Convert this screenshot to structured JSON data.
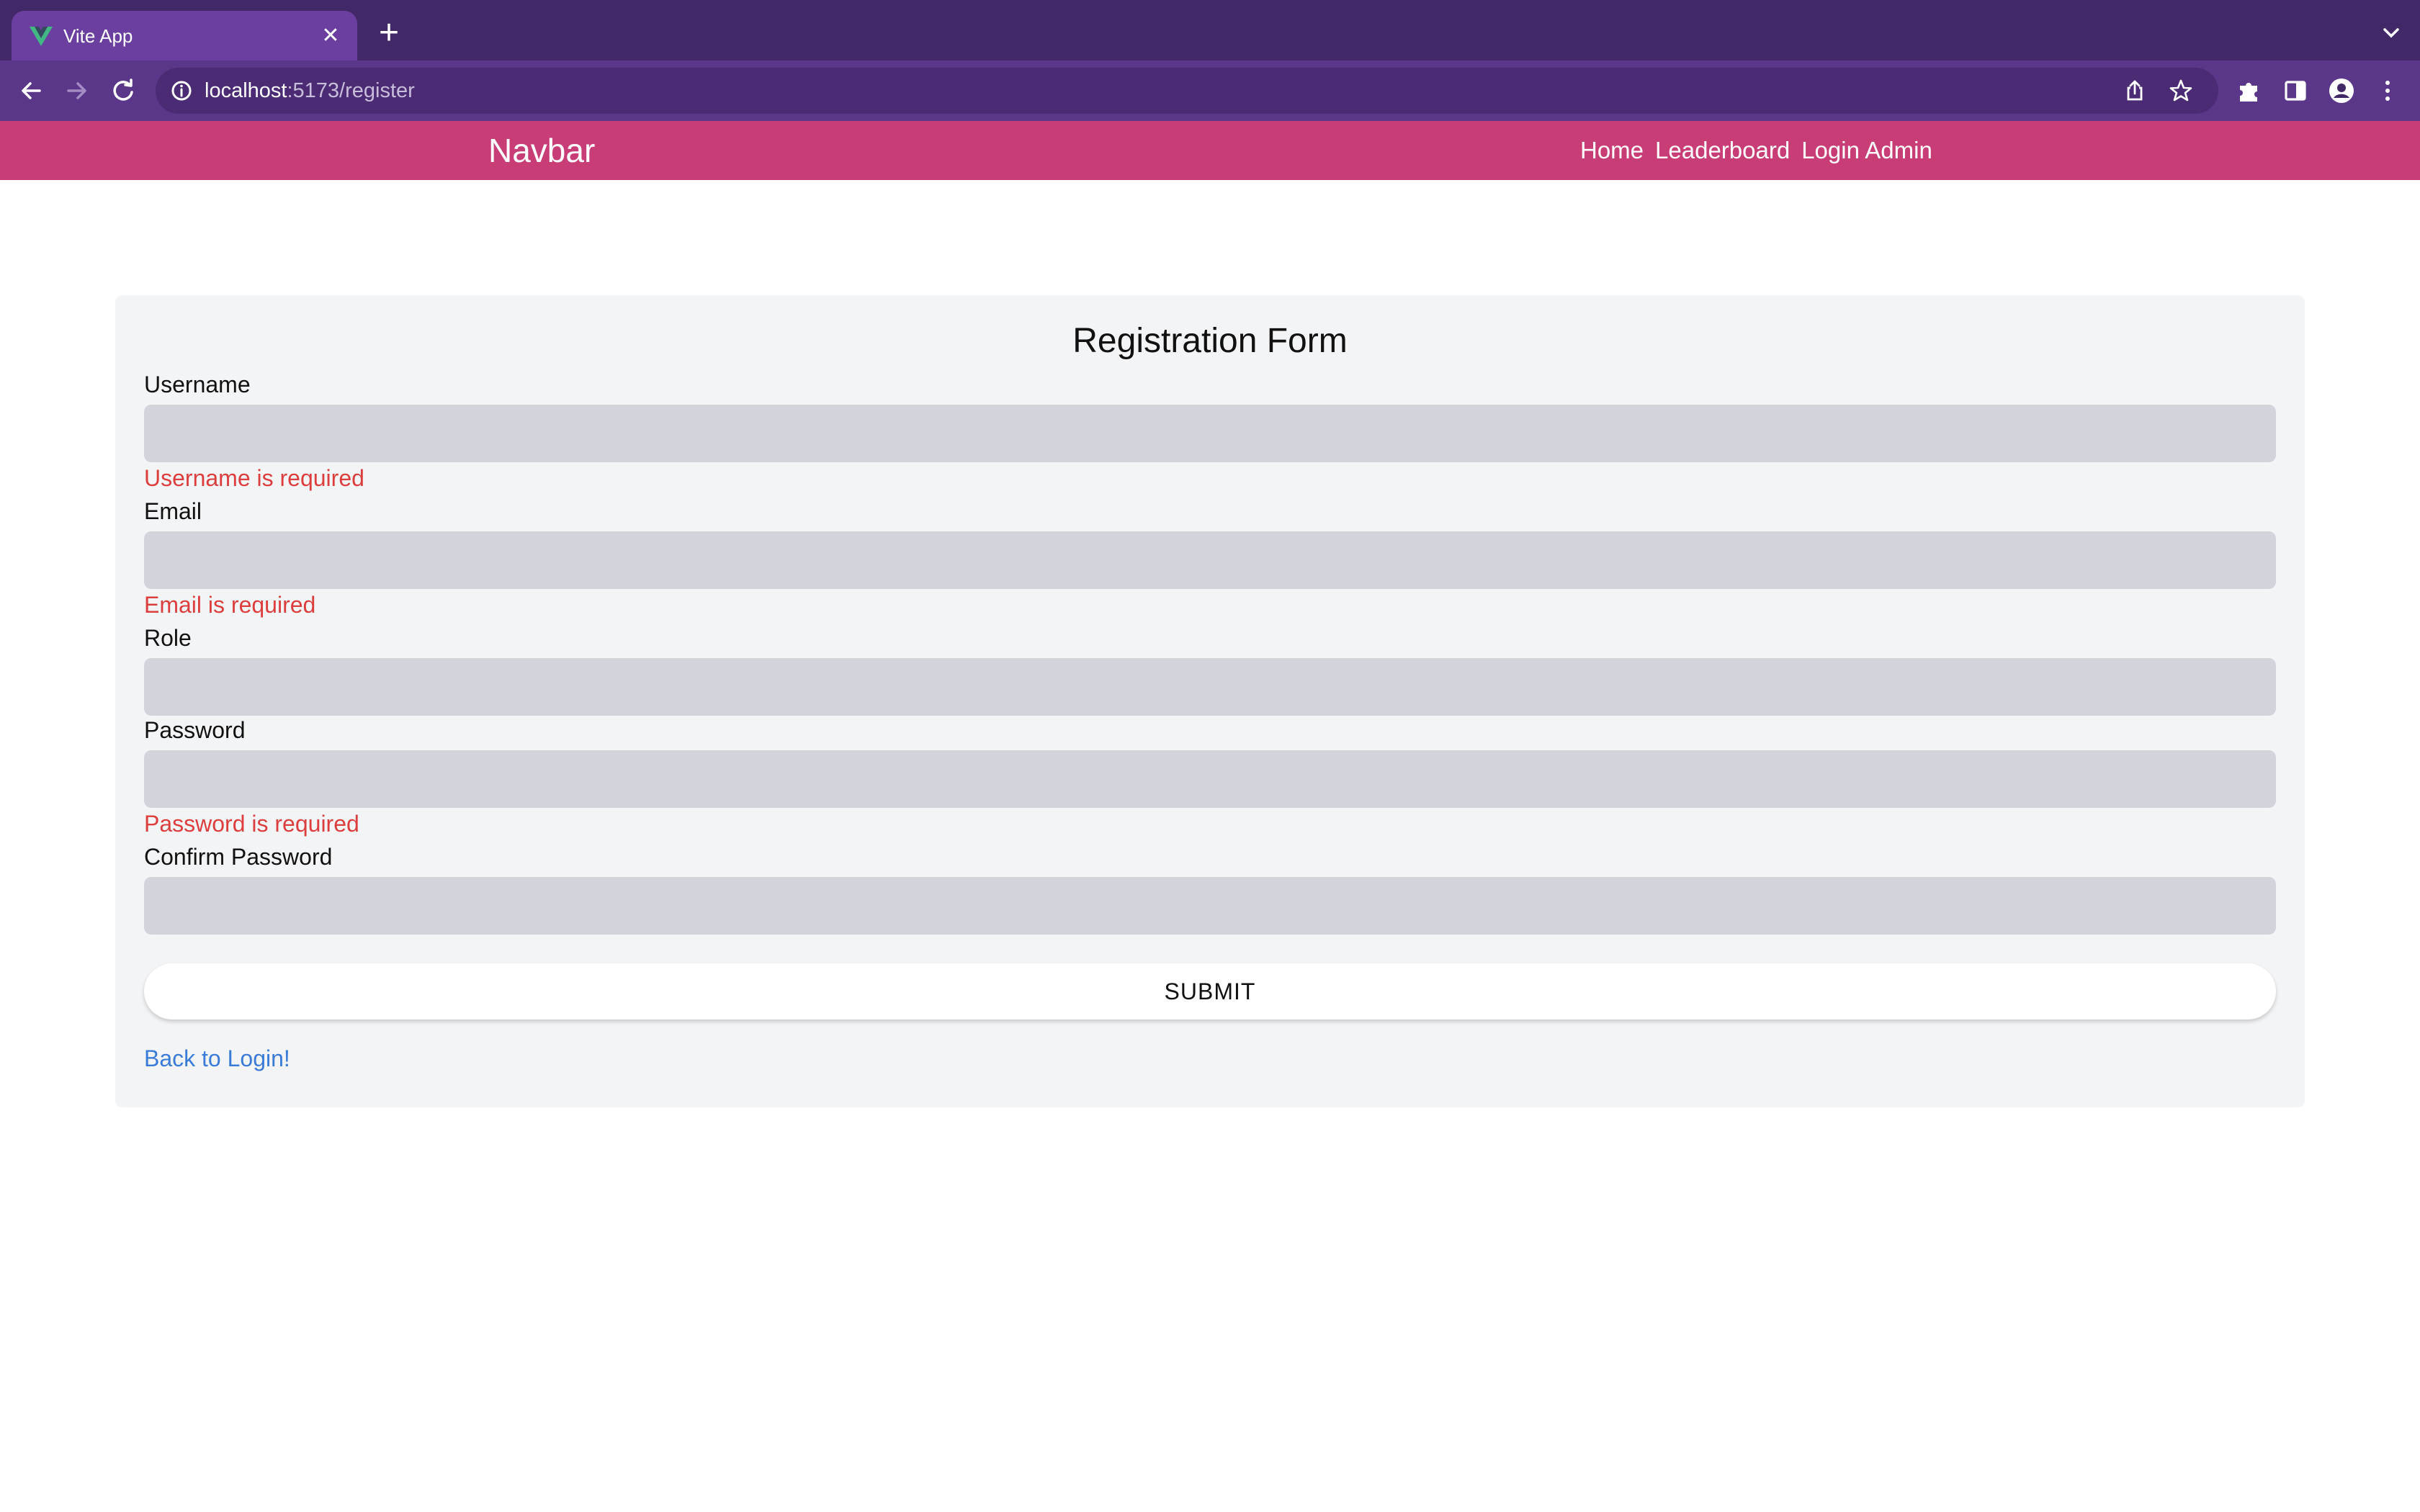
{
  "browser": {
    "tab_title": "Vite App",
    "url_host": "localhost",
    "url_path": ":5173/register",
    "icons": [
      "vite-logo-icon",
      "close-icon",
      "plus-icon",
      "chevron-down-icon",
      "back-arrow-icon",
      "forward-arrow-icon",
      "reload-icon",
      "info-icon",
      "share-icon",
      "star-icon",
      "puzzle-icon",
      "side-panel-icon",
      "profile-icon",
      "kebab-menu-icon"
    ],
    "colors": {
      "tabstrip": "#412866",
      "tab": "#6b3fa0",
      "toolbar": "#5b3789"
    }
  },
  "navbar": {
    "brand": "Navbar",
    "links": [
      "Home",
      "Leaderboard",
      "Login Admin"
    ],
    "color": "#c93d77"
  },
  "form": {
    "title": "Registration Form",
    "fields": [
      {
        "label": "Username",
        "value": "",
        "error": "Username is required"
      },
      {
        "label": "Email",
        "value": "",
        "error": "Email is required"
      },
      {
        "label": "Role",
        "value": "",
        "error": ""
      },
      {
        "label": "Password",
        "value": "",
        "error": "Password is required"
      },
      {
        "label": "Confirm Password",
        "value": "",
        "error": ""
      }
    ],
    "submit_label": "SUBMIT",
    "back_link": "Back to Login!",
    "colors": {
      "error": "#dc3e3e",
      "link": "#3b7bd8",
      "input_bg": "#d1d5db",
      "card_bg": "#f3f4f6"
    }
  }
}
